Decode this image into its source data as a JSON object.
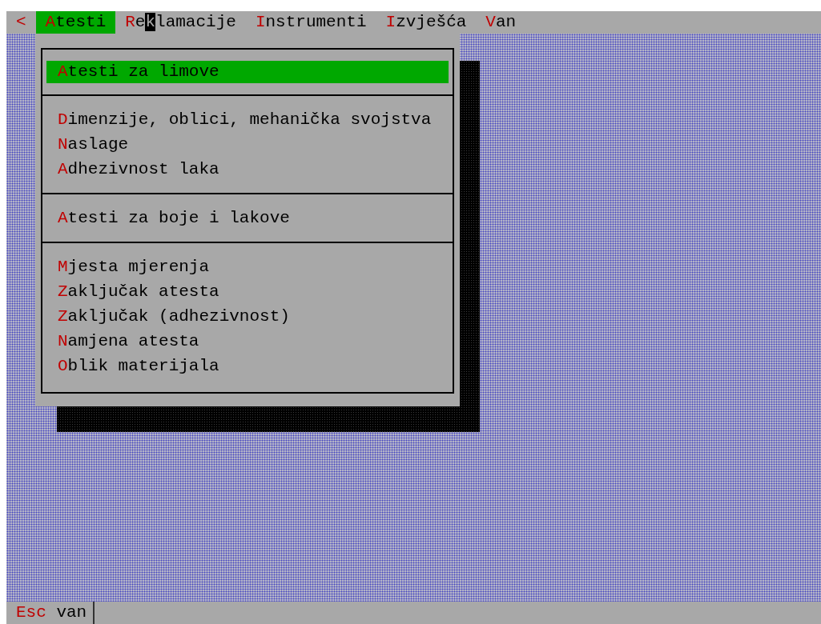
{
  "menu_bar": {
    "back": "<",
    "items": [
      {
        "selected": true,
        "segments": [
          {
            "kind": "hotkey",
            "text": "A"
          },
          {
            "kind": "plain",
            "text": "testi"
          }
        ]
      },
      {
        "selected": false,
        "segments": [
          {
            "kind": "hotkey",
            "text": "R"
          },
          {
            "kind": "plain",
            "text": "e"
          },
          {
            "kind": "cursor",
            "text": "k"
          },
          {
            "kind": "plain",
            "text": "lamacije"
          }
        ]
      },
      {
        "selected": false,
        "segments": [
          {
            "kind": "hotkey",
            "text": "I"
          },
          {
            "kind": "plain",
            "text": "nstrumenti"
          }
        ]
      },
      {
        "selected": false,
        "segments": [
          {
            "kind": "hotkey",
            "text": "I"
          },
          {
            "kind": "plain",
            "text": "zvješća"
          }
        ]
      },
      {
        "selected": false,
        "segments": [
          {
            "kind": "hotkey",
            "text": "V"
          },
          {
            "kind": "plain",
            "text": "an"
          }
        ]
      }
    ]
  },
  "dropdown": {
    "groups": [
      {
        "items": [
          {
            "selected": true,
            "segments": [
              {
                "kind": "hotkey",
                "text": "A"
              },
              {
                "kind": "plain",
                "text": "testi za limove"
              }
            ]
          }
        ]
      },
      {
        "items": [
          {
            "selected": false,
            "segments": [
              {
                "kind": "hotkey",
                "text": "D"
              },
              {
                "kind": "plain",
                "text": "imenzije, oblici, mehanička svojstva"
              }
            ]
          },
          {
            "selected": false,
            "segments": [
              {
                "kind": "hotkey",
                "text": "N"
              },
              {
                "kind": "plain",
                "text": "aslage"
              }
            ]
          },
          {
            "selected": false,
            "segments": [
              {
                "kind": "hotkey",
                "text": "A"
              },
              {
                "kind": "plain",
                "text": "dhezivnost laka"
              }
            ]
          }
        ]
      },
      {
        "items": [
          {
            "selected": false,
            "segments": [
              {
                "kind": "hotkey",
                "text": "A"
              },
              {
                "kind": "plain",
                "text": "testi za boje i lakove"
              }
            ]
          }
        ]
      },
      {
        "items": [
          {
            "selected": false,
            "segments": [
              {
                "kind": "hotkey",
                "text": "M"
              },
              {
                "kind": "plain",
                "text": "jesta mjerenja"
              }
            ]
          },
          {
            "selected": false,
            "segments": [
              {
                "kind": "hotkey",
                "text": "Z"
              },
              {
                "kind": "plain",
                "text": "aključak atesta"
              }
            ]
          },
          {
            "selected": false,
            "segments": [
              {
                "kind": "hotkey",
                "text": "Z"
              },
              {
                "kind": "plain",
                "text": "aključak (adhezivnost)"
              }
            ]
          },
          {
            "selected": false,
            "segments": [
              {
                "kind": "hotkey",
                "text": "N"
              },
              {
                "kind": "plain",
                "text": "amjena atesta"
              }
            ]
          },
          {
            "selected": false,
            "segments": [
              {
                "kind": "hotkey",
                "text": "O"
              },
              {
                "kind": "plain",
                "text": "blik materijala"
              }
            ]
          }
        ]
      }
    ]
  },
  "status_bar": {
    "hints": [
      {
        "segments": [
          {
            "kind": "hotkey",
            "text": "Esc"
          },
          {
            "kind": "plain",
            "text": " van"
          }
        ]
      }
    ]
  }
}
